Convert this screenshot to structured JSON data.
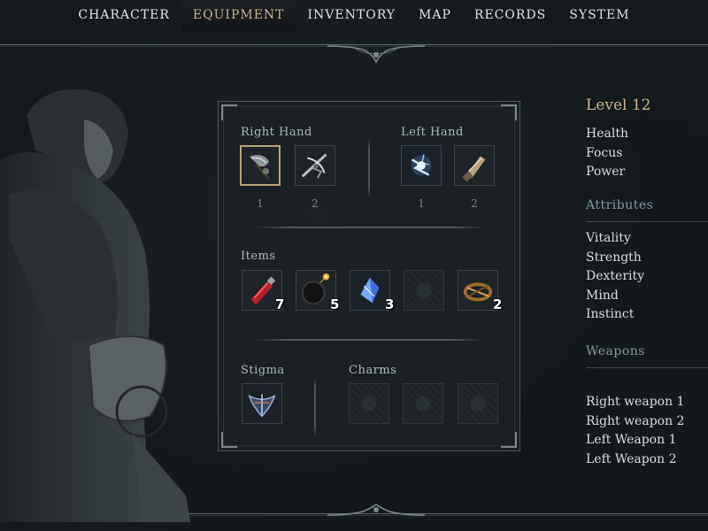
{
  "nav": {
    "tabs": [
      {
        "label": "CHARACTER"
      },
      {
        "label": "EQUIPMENT"
      },
      {
        "label": "INVENTORY"
      },
      {
        "label": "MAP"
      },
      {
        "label": "RECORDS"
      },
      {
        "label": "SYSTEM"
      }
    ],
    "active_tab": "EQUIPMENT"
  },
  "equipment": {
    "right_hand": {
      "label": "Right Hand",
      "slots": [
        {
          "number": "1",
          "icon": "axe-weapon-icon",
          "selected": true
        },
        {
          "number": "2",
          "icon": "crossbow-weapon-icon",
          "selected": false
        }
      ]
    },
    "left_hand": {
      "label": "Left Hand",
      "slots": [
        {
          "number": "1",
          "icon": "lightning-spell-icon",
          "selected": false
        },
        {
          "number": "2",
          "icon": "gauntlet-weapon-icon",
          "selected": false
        }
      ]
    },
    "items": {
      "label": "Items",
      "slots": [
        {
          "icon": "red-potion-icon",
          "count": "7"
        },
        {
          "icon": "bomb-icon",
          "count": "5"
        },
        {
          "icon": "blue-crystal-icon",
          "count": "3"
        },
        {
          "icon": "empty-slot",
          "count": ""
        },
        {
          "icon": "rope-trap-icon",
          "count": "2"
        }
      ]
    },
    "stigma": {
      "label": "Stigma",
      "slots": [
        {
          "icon": "stigma-sigil-icon"
        }
      ]
    },
    "charms": {
      "label": "Charms",
      "slots": [
        {
          "icon": "empty-slot"
        },
        {
          "icon": "empty-slot"
        },
        {
          "icon": "empty-slot"
        }
      ]
    }
  },
  "stats": {
    "level": "Level 12",
    "basic": [
      "Health",
      "Focus",
      "Power"
    ],
    "attributes_heading": "Attributes",
    "attributes": [
      "Vitality",
      "Strength",
      "Dexterity",
      "Mind",
      "Instinct"
    ],
    "weapons_heading": "Weapons",
    "weapons": [
      "Right weapon 1",
      "Right weapon 2",
      "Left Weapon 1",
      "Left Weapon 2"
    ]
  },
  "colors": {
    "accent_gold": "#c8b38e",
    "heading_blue": "#7f9aa6",
    "background": "#141a1d"
  }
}
